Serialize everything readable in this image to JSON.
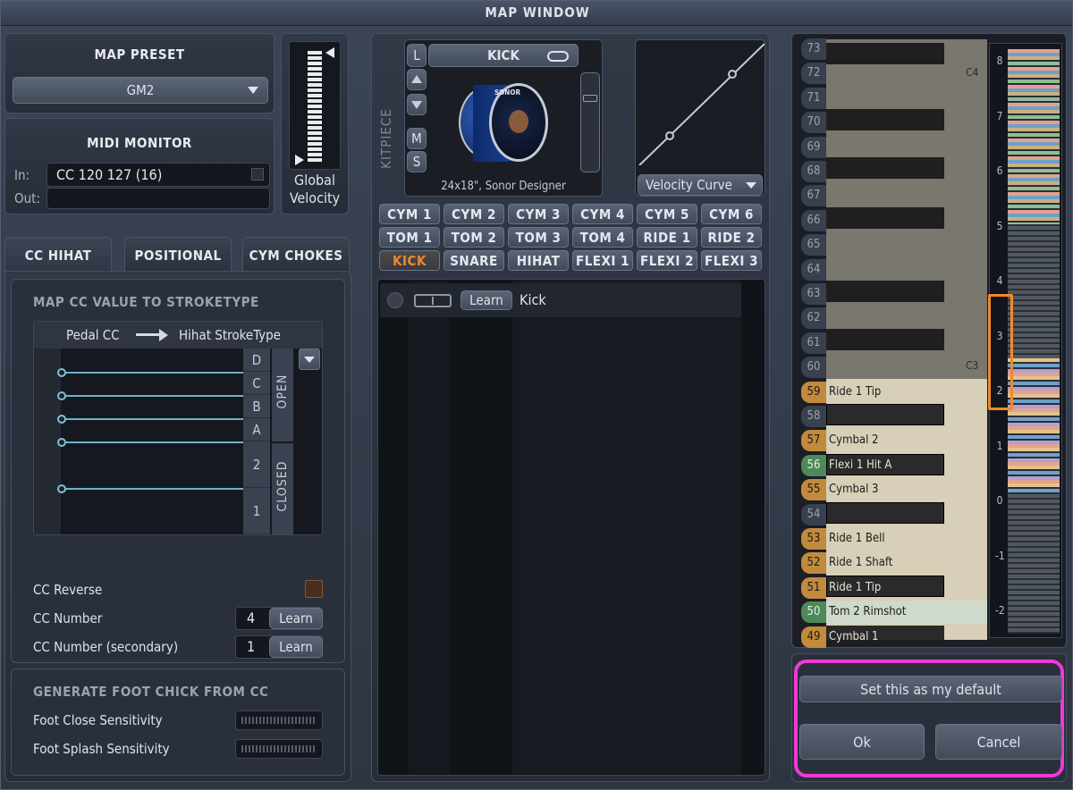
{
  "window": {
    "title": "MAP WINDOW"
  },
  "map_preset": {
    "header": "MAP PRESET",
    "selected": "GM2"
  },
  "midi_monitor": {
    "header": "MIDI MONITOR",
    "in_label": "In:",
    "in_value": "CC 120 127 (16)",
    "out_label": "Out:",
    "out_value": ""
  },
  "global_velocity": {
    "label_line1": "Global",
    "label_line2": "Velocity"
  },
  "tabs": [
    {
      "label": "CC HIHAT",
      "active": true
    },
    {
      "label": "POSITIONAL",
      "active": false
    },
    {
      "label": "CYM CHOKES",
      "active": false
    }
  ],
  "cc_hihat": {
    "section_title": "MAP CC VALUE TO STROKETYPE",
    "pedal_label": "Pedal CC",
    "stroke_label": "Hihat StrokeType",
    "open_letters": [
      "D",
      "C",
      "B",
      "A"
    ],
    "closed_numbers": [
      "2",
      "1"
    ],
    "open_label": "OPEN",
    "closed_label": "CLOSED",
    "cc_reverse_label": "CC Reverse",
    "cc_number_label": "CC Number",
    "cc_number_value": "4",
    "cc_number_secondary_label": "CC Number (secondary)",
    "cc_number_secondary_value": "1",
    "learn_label": "Learn"
  },
  "foot_chick": {
    "title": "GENERATE FOOT CHICK FROM CC",
    "close_label": "Foot Close Sensitivity",
    "splash_label": "Foot Splash Sensitivity"
  },
  "kitpiece": {
    "side_label": "KITPIECE",
    "name": "KICK",
    "description": "24x18\", Sonor Designer",
    "buttons": {
      "l": "L",
      "m": "M",
      "s": "S"
    },
    "drum_brand": "SONOR"
  },
  "velocity_curve": {
    "label": "Velocity Curve"
  },
  "kit_grid": [
    [
      "CYM 1",
      "CYM 2",
      "CYM 3",
      "CYM 4",
      "CYM 5",
      "CYM 6"
    ],
    [
      "TOM 1",
      "TOM 2",
      "TOM 3",
      "TOM 4",
      "RIDE 1",
      "RIDE 2"
    ],
    [
      "KICK",
      "SNARE",
      "HIHAT",
      "FLEXI 1",
      "FLEXI 2",
      "FLEXI 3"
    ]
  ],
  "mapping_list": {
    "learn_label": "Learn",
    "item_name": "Kick"
  },
  "keyboard": {
    "c4_label": "C4",
    "c3_label": "C3",
    "notes": [
      {
        "num": "73",
        "name": ""
      },
      {
        "num": "72",
        "name": ""
      },
      {
        "num": "71",
        "name": ""
      },
      {
        "num": "70",
        "name": ""
      },
      {
        "num": "69",
        "name": ""
      },
      {
        "num": "68",
        "name": ""
      },
      {
        "num": "67",
        "name": ""
      },
      {
        "num": "66",
        "name": ""
      },
      {
        "num": "65",
        "name": ""
      },
      {
        "num": "64",
        "name": ""
      },
      {
        "num": "63",
        "name": ""
      },
      {
        "num": "62",
        "name": ""
      },
      {
        "num": "61",
        "name": ""
      },
      {
        "num": "60",
        "name": ""
      },
      {
        "num": "59",
        "name": "Ride 1 Tip"
      },
      {
        "num": "58",
        "name": ""
      },
      {
        "num": "57",
        "name": "Cymbal 2"
      },
      {
        "num": "56",
        "name": "Flexi 1 Hit A"
      },
      {
        "num": "55",
        "name": "Cymbal 3"
      },
      {
        "num": "54",
        "name": ""
      },
      {
        "num": "53",
        "name": "Ride 1 Bell"
      },
      {
        "num": "52",
        "name": "Ride 1 Shaft"
      },
      {
        "num": "51",
        "name": "Ride 1 Tip"
      },
      {
        "num": "50",
        "name": "Tom 2 Rimshot"
      },
      {
        "num": "49",
        "name": "Cymbal 1"
      }
    ],
    "octaves": [
      "8",
      "7",
      "6",
      "5",
      "4",
      "3",
      "2",
      "1",
      "0",
      "-1",
      "-2"
    ]
  },
  "footer": {
    "default_label": "Set this as my default",
    "ok_label": "Ok",
    "cancel_label": "Cancel"
  },
  "colors": {
    "accent_orange": "#f08a2a",
    "highlight_magenta": "#ee3ad8",
    "cc_line": "#6fb2c7"
  }
}
